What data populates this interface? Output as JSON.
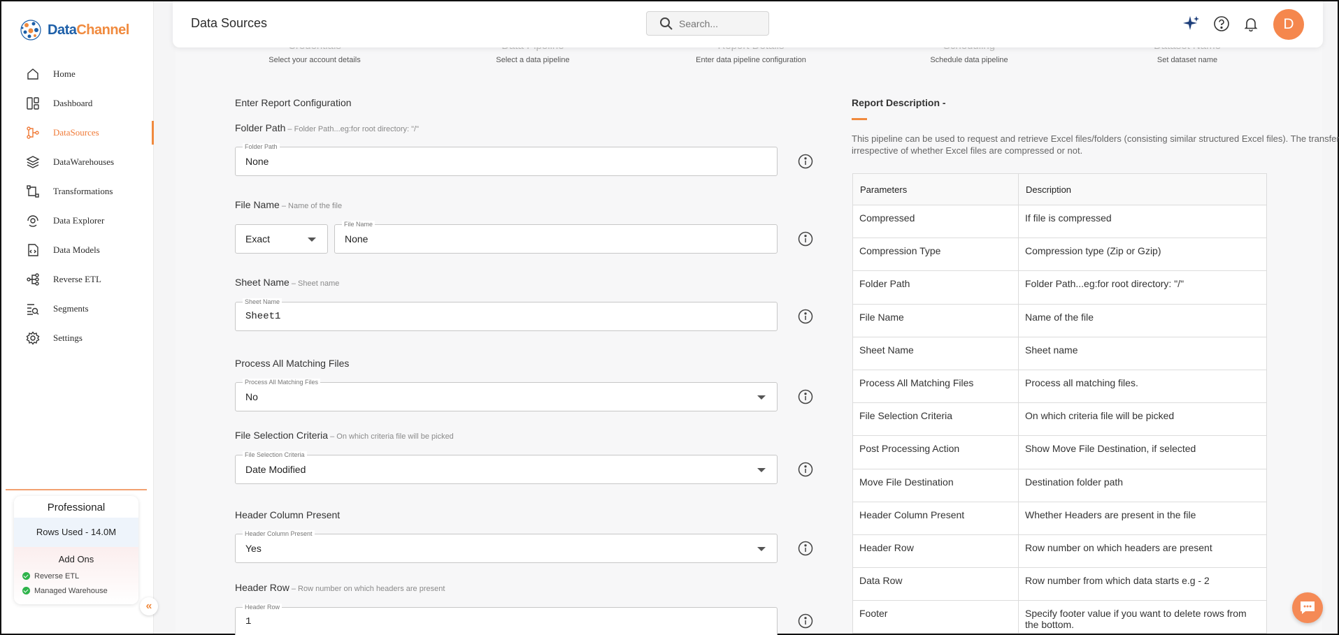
{
  "brand": {
    "name_part1": "Data",
    "name_part2": "Channel"
  },
  "nav": [
    {
      "label": "Home",
      "icon": "home-icon"
    },
    {
      "label": "Dashboard",
      "icon": "dashboard-icon"
    },
    {
      "label": "DataSources",
      "icon": "datasources-icon",
      "active": true
    },
    {
      "label": "DataWarehouses",
      "icon": "datawarehouses-icon"
    },
    {
      "label": "Transformations",
      "icon": "transformations-icon"
    },
    {
      "label": "Data Explorer",
      "icon": "data-explorer-icon"
    },
    {
      "label": "Data Models",
      "icon": "data-models-icon"
    },
    {
      "label": "Reverse ETL",
      "icon": "reverse-etl-icon"
    },
    {
      "label": "Segments",
      "icon": "segments-icon"
    },
    {
      "label": "Settings",
      "icon": "settings-icon"
    }
  ],
  "plan": {
    "name": "Professional",
    "rows_used": "Rows Used - 14.0M",
    "addons_title": "Add Ons",
    "addons": [
      "Reverse ETL",
      "Managed Warehouse"
    ],
    "collapse_glyph": "«"
  },
  "header": {
    "title": "Data Sources",
    "search_placeholder": "Search...",
    "avatar_initial": "D"
  },
  "steps": [
    {
      "title": "Credentials",
      "subtitle": "Select your account details"
    },
    {
      "title": "Data Pipeline",
      "subtitle": "Select a data pipeline"
    },
    {
      "title": "Report Details",
      "subtitle": "Enter data pipeline configuration"
    },
    {
      "title": "Scheduling",
      "subtitle": "Schedule data pipeline"
    },
    {
      "title": "Dataset Name",
      "subtitle": "Set dataset name"
    }
  ],
  "form": {
    "section_title": "Enter Report Configuration",
    "folder_path": {
      "label": "Folder Path",
      "hint": " – Folder Path...eg:for root directory: \"/\"",
      "float": "Folder Path",
      "value": "None"
    },
    "file_name": {
      "label": "File Name",
      "hint": " – Name of the file",
      "match_value": "Exact",
      "float": "File Name",
      "value": "None"
    },
    "sheet_name": {
      "label": "Sheet Name",
      "hint": " – Sheet name",
      "float": "Sheet Name",
      "value": "Sheet1"
    },
    "process_all": {
      "label": "Process All Matching Files",
      "float": "Process All Matching Files",
      "value": "No"
    },
    "file_selection": {
      "label": "File Selection Criteria",
      "hint": " – On which criteria file will be picked",
      "float": "File Selection Criteria",
      "value": "Date Modified"
    },
    "header_column": {
      "label": "Header Column Present",
      "float": "Header Column Present",
      "value": "Yes"
    },
    "header_row": {
      "label": "Header Row",
      "hint": " – Row number on which headers are present",
      "float": "Header Row",
      "value": "1"
    }
  },
  "description": {
    "title": "Report Description -",
    "text": "This pipeline can be used to request and retrieve Excel files/folders (consisting similar structured Excel files). The transfer is enabled irrespective of whether Excel files are compressed or not.",
    "columns": [
      "Parameters",
      "Description"
    ],
    "rows": [
      [
        "Compressed",
        "If file is compressed"
      ],
      [
        "Compression Type",
        "Compression type (Zip or Gzip)"
      ],
      [
        "Folder Path",
        "Folder Path...eg:for root directory: \"/\""
      ],
      [
        "File Name",
        "Name of the file"
      ],
      [
        "Sheet Name",
        "Sheet name"
      ],
      [
        "Process All Matching Files",
        "Process all matching files."
      ],
      [
        "File Selection Criteria",
        "On which criteria file will be picked"
      ],
      [
        "Post Processing Action",
        "Show Move File Destination, if selected"
      ],
      [
        "Move File Destination",
        "Destination folder path"
      ],
      [
        "Header Column Present",
        "Whether Headers are present in the file"
      ],
      [
        "Header Row",
        "Row number on which headers are present"
      ],
      [
        "Data Row",
        "Row number from which data starts e.g - 2"
      ],
      [
        "Footer",
        "Specify footer value if you want to delete rows from the bottom."
      ]
    ]
  },
  "colors": {
    "accent": "#f08a3e",
    "brand_blue": "#1d5fa8",
    "success": "#2eb34a"
  }
}
